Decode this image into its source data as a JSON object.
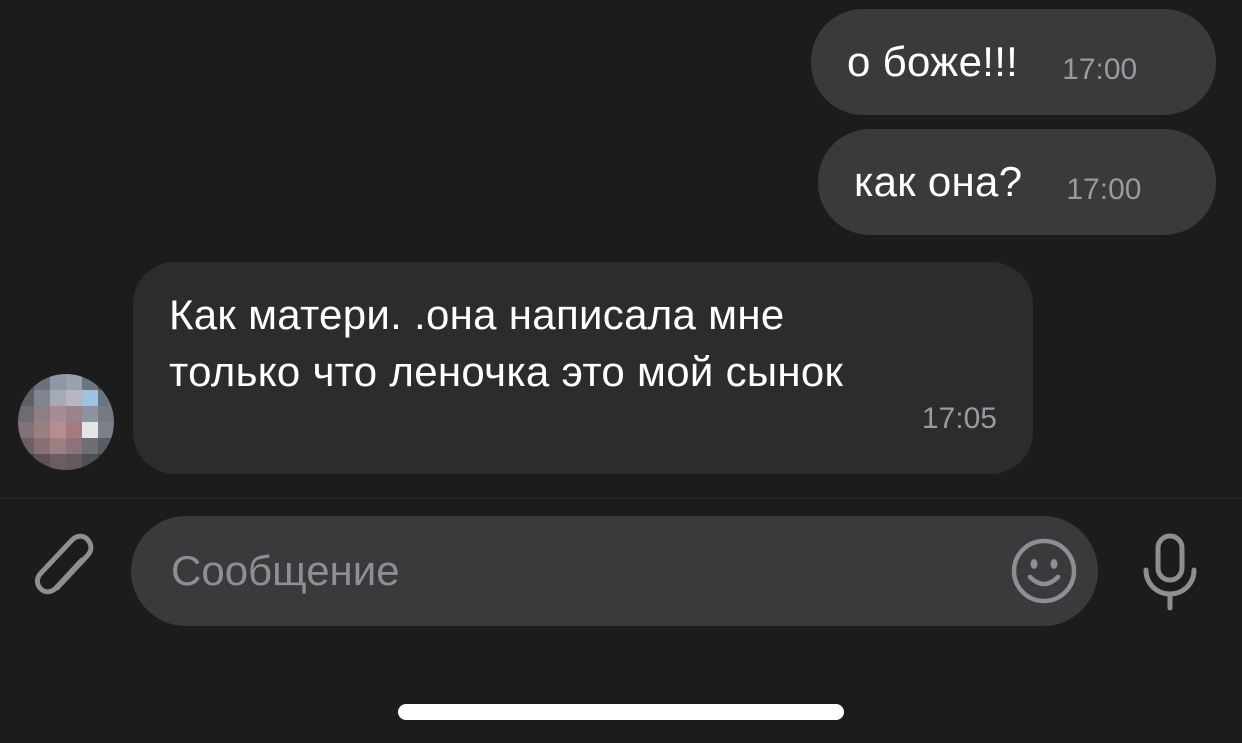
{
  "messages": [
    {
      "direction": "outgoing",
      "text": "о боже!!!",
      "time": "17:00"
    },
    {
      "direction": "outgoing",
      "text": "как она?",
      "time": "17:00"
    },
    {
      "direction": "incoming",
      "text_line1": "Как матери. .она написала мне",
      "text_line2": "только что леночка это мой сынок",
      "time": "17:05"
    }
  ],
  "composer": {
    "placeholder": "Сообщение",
    "icons": [
      "paperclip-icon",
      "smiley-icon",
      "microphone-icon"
    ]
  },
  "colors": {
    "background": "#1c1c1d",
    "outgoing_bubble": "#3a3a3c",
    "incoming_bubble": "#2c2c2e",
    "timestamp": "#9a9a9e",
    "placeholder": "#8e8e93",
    "icon": "#8e8e93"
  }
}
